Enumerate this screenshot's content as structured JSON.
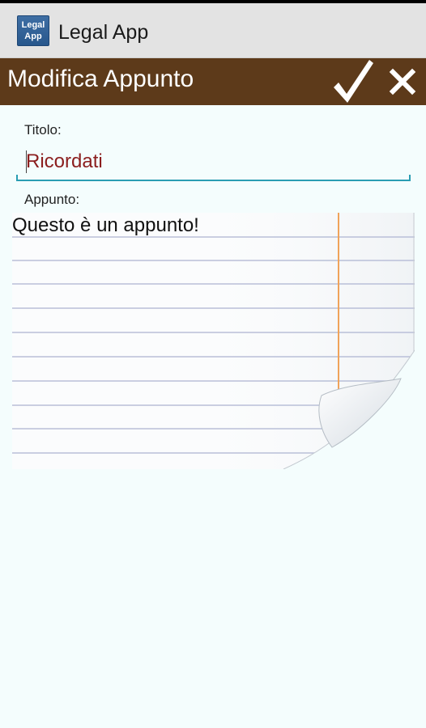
{
  "app": {
    "logo_line1": "Legal",
    "logo_line2": "App",
    "title": "Legal App"
  },
  "header": {
    "title": "Modifica Appunto",
    "confirm_icon": "checkmark-icon",
    "cancel_icon": "close-icon",
    "background": "#5d3a1a"
  },
  "form": {
    "title_label": "Titolo:",
    "title_value": "Ricordati",
    "note_label": "Appunto:",
    "note_value": "Questo è un appunto!"
  },
  "colors": {
    "accent": "#2a9db3",
    "title_text": "#8b1e1e",
    "background": "#f4fdfd"
  }
}
